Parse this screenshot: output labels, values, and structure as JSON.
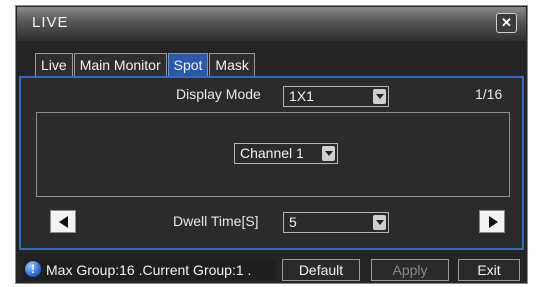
{
  "window": {
    "title": "LIVE",
    "close_icon": "close-icon"
  },
  "tabs": [
    {
      "label": "Live",
      "active": false
    },
    {
      "label": "Main Monitor",
      "active": false
    },
    {
      "label": "Spot",
      "active": true
    },
    {
      "label": "Mask",
      "active": false
    }
  ],
  "display_mode": {
    "label": "Display Mode",
    "value": "1X1",
    "page": "1/16"
  },
  "channel": {
    "value": "Channel 1"
  },
  "dwell": {
    "label": "Dwell Time[S]",
    "value": "5"
  },
  "status": {
    "text": "Max Group:16 .Current Group:1 ."
  },
  "buttons": {
    "default": "Default",
    "apply": "Apply",
    "exit": "Exit"
  },
  "colors": {
    "accent": "#2e6dc7",
    "tab_active": "#2a5aa6",
    "background": "#242424"
  }
}
